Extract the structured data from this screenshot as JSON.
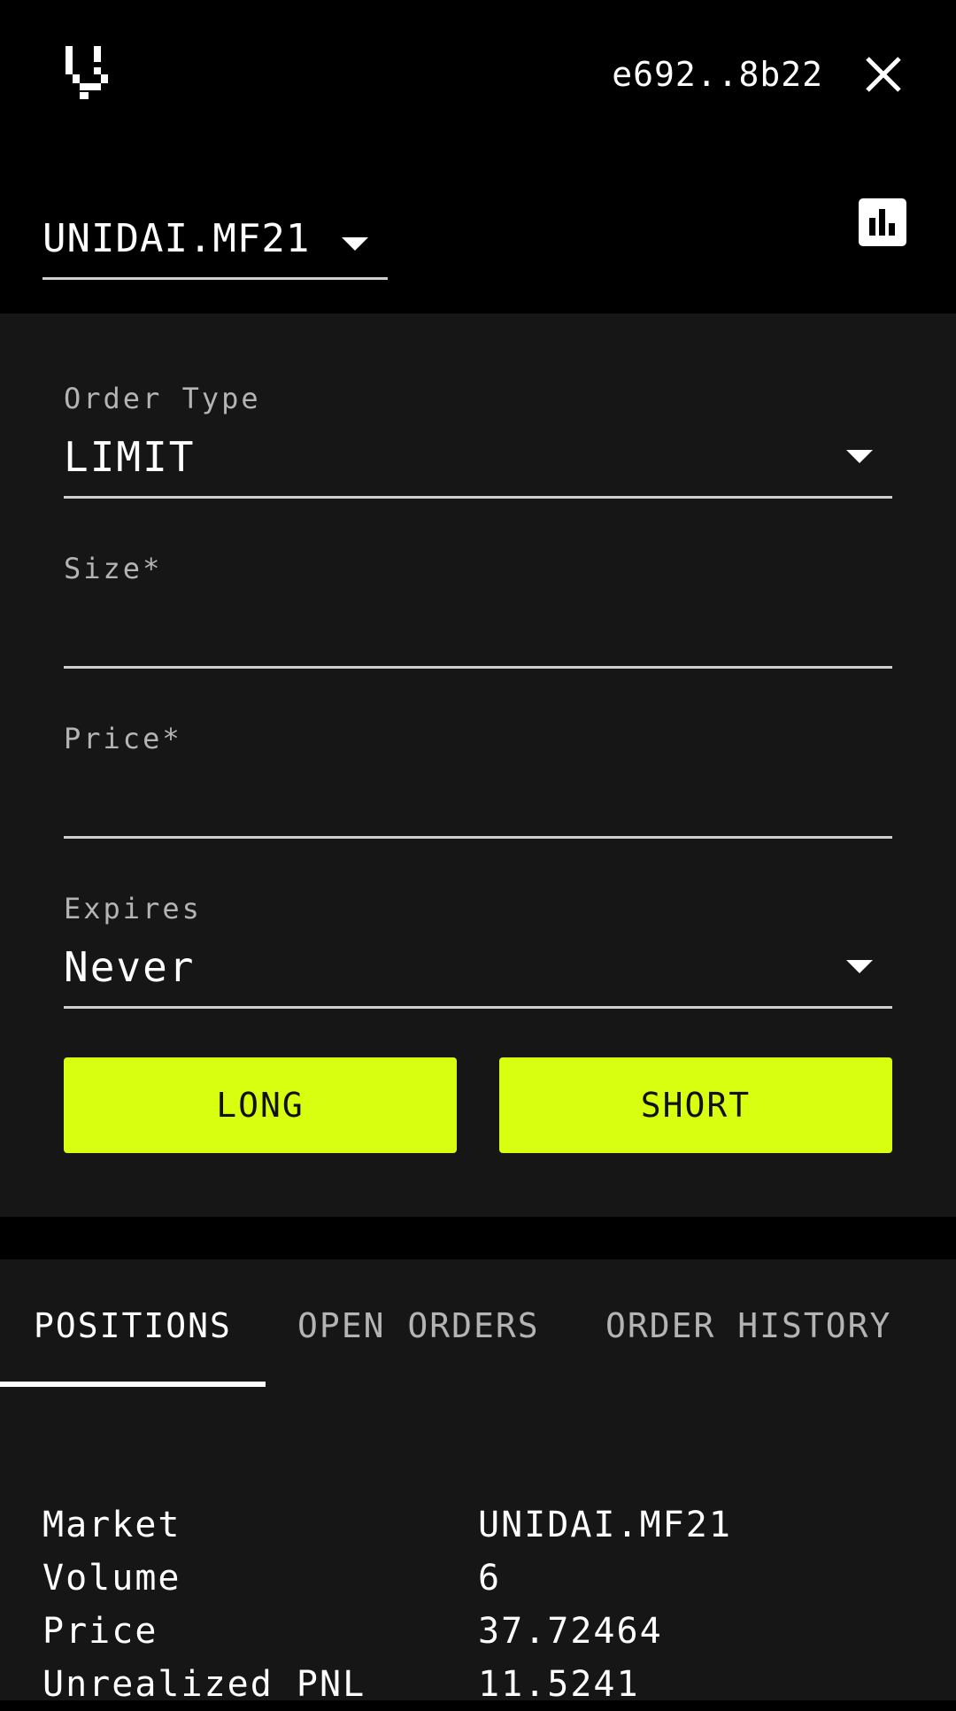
{
  "header": {
    "wallet_address": "e692..8b22"
  },
  "market_selector": {
    "selected": "UNIDAI.MF21"
  },
  "order_form": {
    "order_type": {
      "label": "Order Type",
      "value": "LIMIT"
    },
    "size": {
      "label": "Size",
      "required_mark": "*",
      "value": ""
    },
    "price": {
      "label": "Price",
      "required_mark": "*",
      "value": ""
    },
    "expires": {
      "label": "Expires",
      "value": "Never"
    },
    "long_label": "LONG",
    "short_label": "SHORT"
  },
  "tabs": [
    {
      "label": "POSITIONS",
      "active": true
    },
    {
      "label": "OPEN ORDERS",
      "active": false
    },
    {
      "label": "ORDER HISTORY",
      "active": false
    }
  ],
  "position": {
    "rows": [
      {
        "key": "Market",
        "value": "UNIDAI.MF21"
      },
      {
        "key": "Volume",
        "value": "6"
      },
      {
        "key": "Price",
        "value": "37.72464"
      },
      {
        "key": "Unrealized PNL",
        "value": "11.5241"
      }
    ]
  },
  "colors": {
    "accent": "#d8ff0f",
    "background": "#000000",
    "panel": "#161616"
  },
  "icons": {
    "logo": "vega-logo-icon",
    "close": "close-icon",
    "chart": "bar-chart-icon",
    "caret": "caret-down-icon"
  }
}
